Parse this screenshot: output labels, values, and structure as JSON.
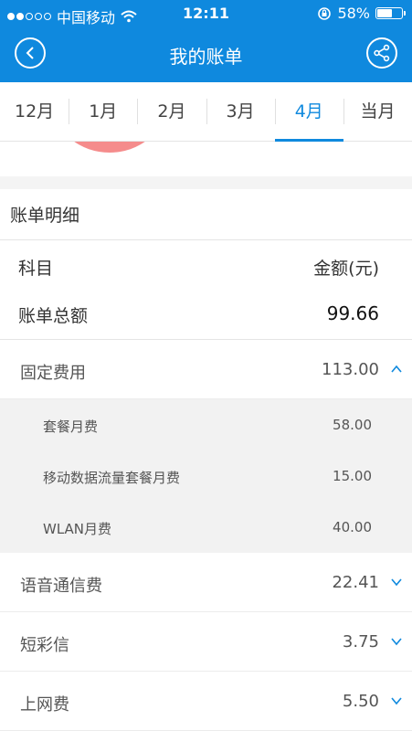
{
  "status": {
    "carrier": "中国移动",
    "time": "12:11",
    "battery_percent": "58%",
    "battery_level": 0.58
  },
  "nav": {
    "title": "我的账单"
  },
  "tabs": [
    {
      "label": "12月",
      "active": false
    },
    {
      "label": "1月",
      "active": false
    },
    {
      "label": "2月",
      "active": false
    },
    {
      "label": "3月",
      "active": false
    },
    {
      "label": "4月",
      "active": true
    },
    {
      "label": "当月",
      "active": false
    }
  ],
  "detail": {
    "section_title": "账单明细",
    "header": {
      "subject": "科目",
      "amount": "金额(元)"
    },
    "total": {
      "label": "账单总额",
      "amount": "99.66"
    },
    "categories": [
      {
        "label": "固定费用",
        "amount": "113.00",
        "expanded": true,
        "items": [
          {
            "label": "套餐月费",
            "amount": "58.00"
          },
          {
            "label": "移动数据流量套餐月费",
            "amount": "15.00"
          },
          {
            "label": "WLAN月费",
            "amount": "40.00"
          }
        ]
      },
      {
        "label": "语音通信费",
        "amount": "22.41",
        "expanded": false
      },
      {
        "label": "短彩信",
        "amount": "3.75",
        "expanded": false
      },
      {
        "label": "上网费",
        "amount": "5.50",
        "expanded": false
      }
    ]
  },
  "colors": {
    "accent": "#0f89de",
    "pie_slice": "#f58c8c"
  }
}
